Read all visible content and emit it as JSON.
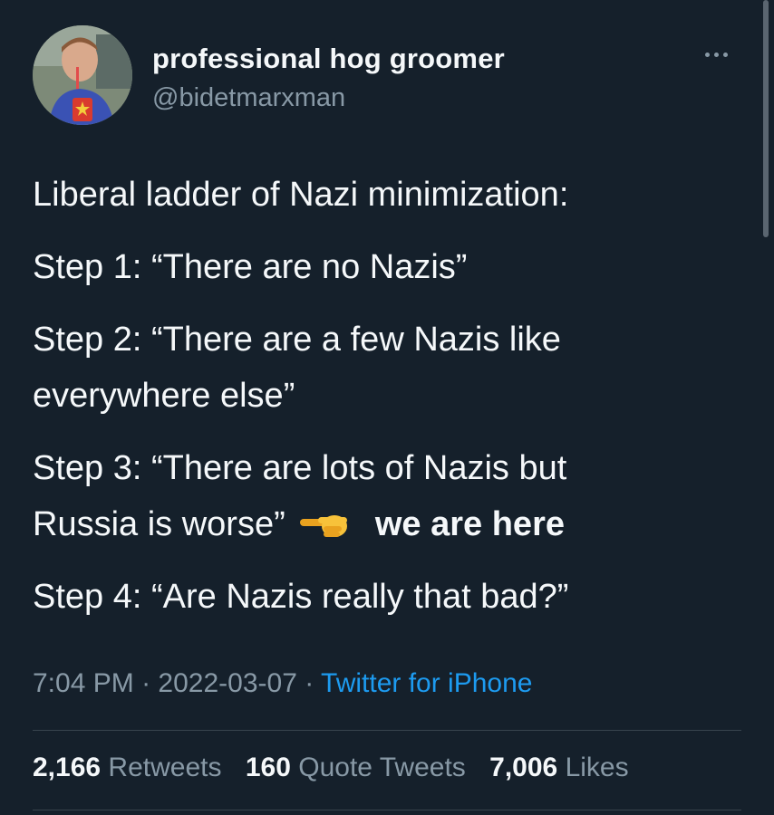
{
  "author": {
    "display_name": "professional hog groomer",
    "handle": "@bidetmarxman"
  },
  "tweet": {
    "intro": "Liberal ladder of Nazi minimization:",
    "step1": "Step 1: “There are no Nazis”",
    "step2_line1": "Step 2: “There are a few Nazis like",
    "step2_line2": "everywhere else”",
    "step3_line1": "Step 3: “There are lots of Nazis but",
    "step3_line2": "Russia is worse”",
    "step3_emphasis": "we are here",
    "step3_emoji": "pointing-right-hand-icon",
    "step4": "Step 4: “Are Nazis really that bad?”"
  },
  "meta": {
    "time": "7:04 PM",
    "sep1": "·",
    "date": "2022-03-07",
    "sep2": "·",
    "source": "Twitter for iPhone"
  },
  "stats": {
    "retweets_count": "2,166",
    "retweets_label": "Retweets",
    "quotes_count": "160",
    "quotes_label": "Quote Tweets",
    "likes_count": "7,006",
    "likes_label": "Likes"
  },
  "colors": {
    "background": "#15202b",
    "text": "#f5f8fa",
    "muted": "#8899a6",
    "link": "#1d9bf0"
  }
}
